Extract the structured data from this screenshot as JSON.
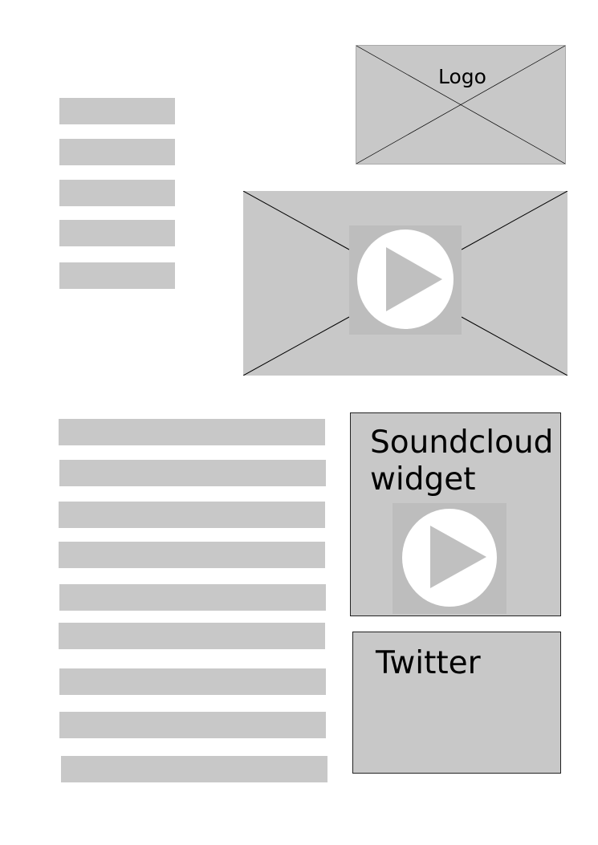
{
  "logo": {
    "label": "Logo"
  },
  "nav_menu": {
    "item_count": 5
  },
  "video": {
    "icon": "play-icon"
  },
  "text_block": {
    "line_count": 9
  },
  "soundcloud": {
    "title": "Soundcloud\nwidget",
    "icon": "play-icon"
  },
  "twitter": {
    "title": "Twitter"
  },
  "colors": {
    "placeholder_fill": "#c8c8c8",
    "play_background": "#bdbdbd",
    "play_circle": "#ffffff",
    "page_background": "#ffffff"
  }
}
